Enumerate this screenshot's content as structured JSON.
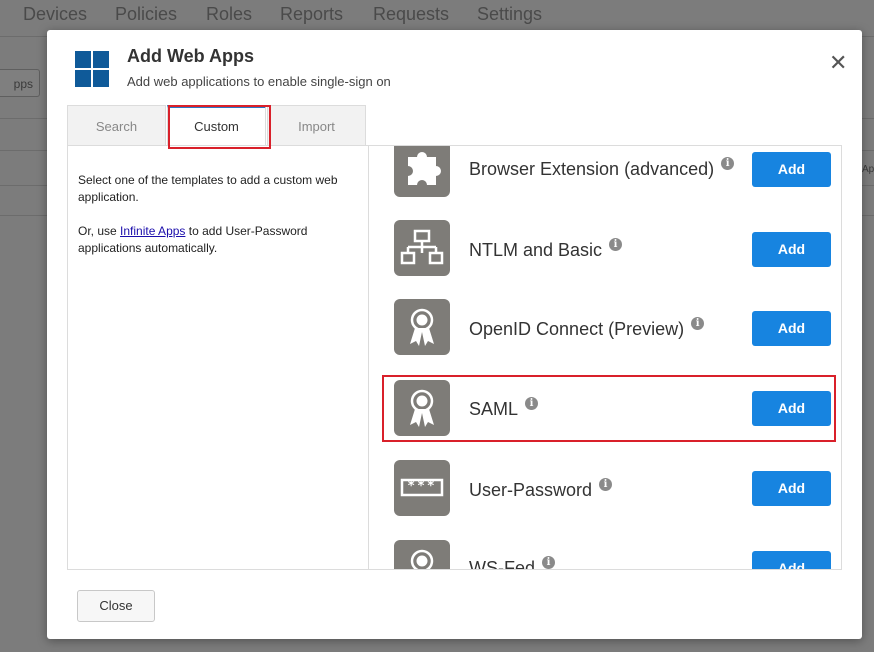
{
  "background": {
    "nav": [
      "Devices",
      "Policies",
      "Roles",
      "Reports",
      "Requests",
      "Settings"
    ],
    "left_button": "pps",
    "right_cut": "Ap"
  },
  "dialog": {
    "title": "Add Web Apps",
    "subtitle": "Add web applications to enable single-sign on",
    "close_symbol": "✕",
    "tabs": [
      {
        "label": "Search"
      },
      {
        "label": "Custom",
        "active": true
      },
      {
        "label": "Import"
      }
    ],
    "left_panel": {
      "line1": "Select one of the templates to add a custom web application.",
      "line2_prefix": "Or, use ",
      "line2_link": "Infinite Apps",
      "line2_suffix": " to add User-Password applications automatically."
    },
    "templates": [
      {
        "name": "Browser Extension (advanced)",
        "icon": "puzzle-icon",
        "button": "Add"
      },
      {
        "name": "NTLM and Basic",
        "icon": "network-icon",
        "button": "Add"
      },
      {
        "name": "OpenID Connect (Preview)",
        "icon": "ribbon-icon",
        "button": "Add"
      },
      {
        "name": "SAML",
        "icon": "ribbon-icon",
        "button": "Add",
        "highlighted": true
      },
      {
        "name": "User-Password",
        "icon": "password-icon",
        "button": "Add"
      },
      {
        "name": "WS-Fed",
        "icon": "ribbon-icon",
        "button": "Add"
      }
    ],
    "info_glyph": "i",
    "password_mask": "***",
    "footer_button": "Close"
  },
  "colors": {
    "accent": "#1784e0",
    "tab_accent": "#2b76c5",
    "highlight": "#d9202a",
    "logo": "#0f5a99"
  }
}
